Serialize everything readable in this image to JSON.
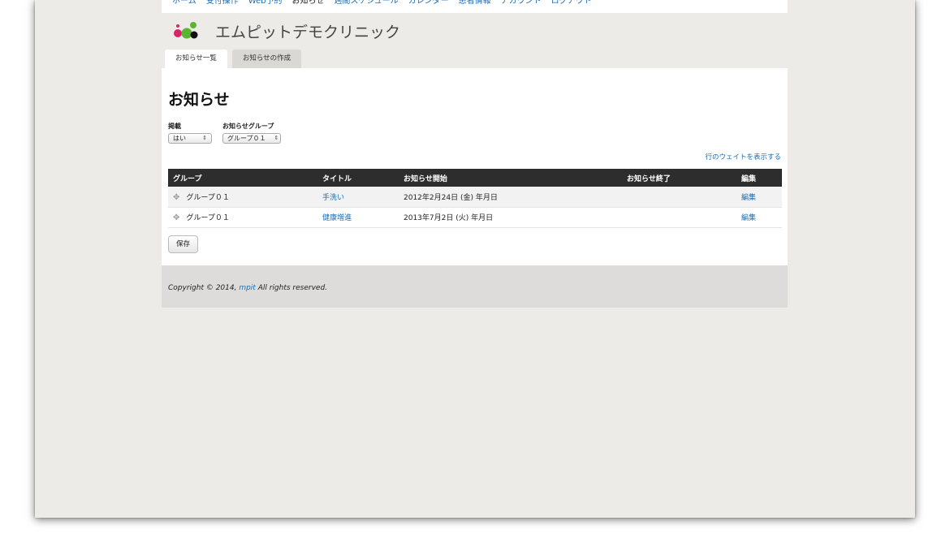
{
  "nav": {
    "items": [
      {
        "label": "ホーム",
        "active": false
      },
      {
        "label": "受付操作",
        "active": false
      },
      {
        "label": "Web予約",
        "active": false
      },
      {
        "label": "お知らせ",
        "active": true
      },
      {
        "label": "週間スケジュール",
        "active": false
      },
      {
        "label": "カレンダー",
        "active": false
      },
      {
        "label": "患者情報",
        "active": false
      },
      {
        "label": "アカウント",
        "active": false
      },
      {
        "label": "ログアウト",
        "active": false
      }
    ]
  },
  "site": {
    "name": "エムピットデモクリニック"
  },
  "tabs": [
    {
      "label": "お知らせ一覧",
      "active": true
    },
    {
      "label": "お知らせの作成",
      "active": false
    }
  ],
  "page": {
    "title": "お知らせ"
  },
  "filters": {
    "published": {
      "label": "掲載",
      "value": "はい"
    },
    "group": {
      "label": "お知らせグループ",
      "value": "グループ０１"
    }
  },
  "weight_link": "行のウェイトを表示する",
  "table": {
    "headers": [
      "グループ",
      "タイトル",
      "お知らせ開始",
      "お知らせ終了",
      "編集"
    ],
    "rows": [
      {
        "group": "グループ０１",
        "title": "手洗い",
        "start": "2012年2月24日 (金) 年月日",
        "end": "",
        "edit": "編集"
      },
      {
        "group": "グループ０１",
        "title": "健康増進",
        "start": "2013年7月2日 (火) 年月日",
        "end": "",
        "edit": "編集"
      }
    ]
  },
  "save_label": "保存",
  "footer": {
    "prefix": "Copyright © 2014, ",
    "link": "mpit",
    "suffix": " All rights reserved."
  },
  "icons": {
    "logo": "clinic-logo",
    "drag": "drag-handle-icon",
    "select_arrow": "updown-arrow-icon"
  },
  "colors": {
    "link": "#1b6bb3",
    "table_header": "#2d2d2d",
    "logo_green": "#5cb531",
    "logo_magenta": "#d8246a"
  }
}
